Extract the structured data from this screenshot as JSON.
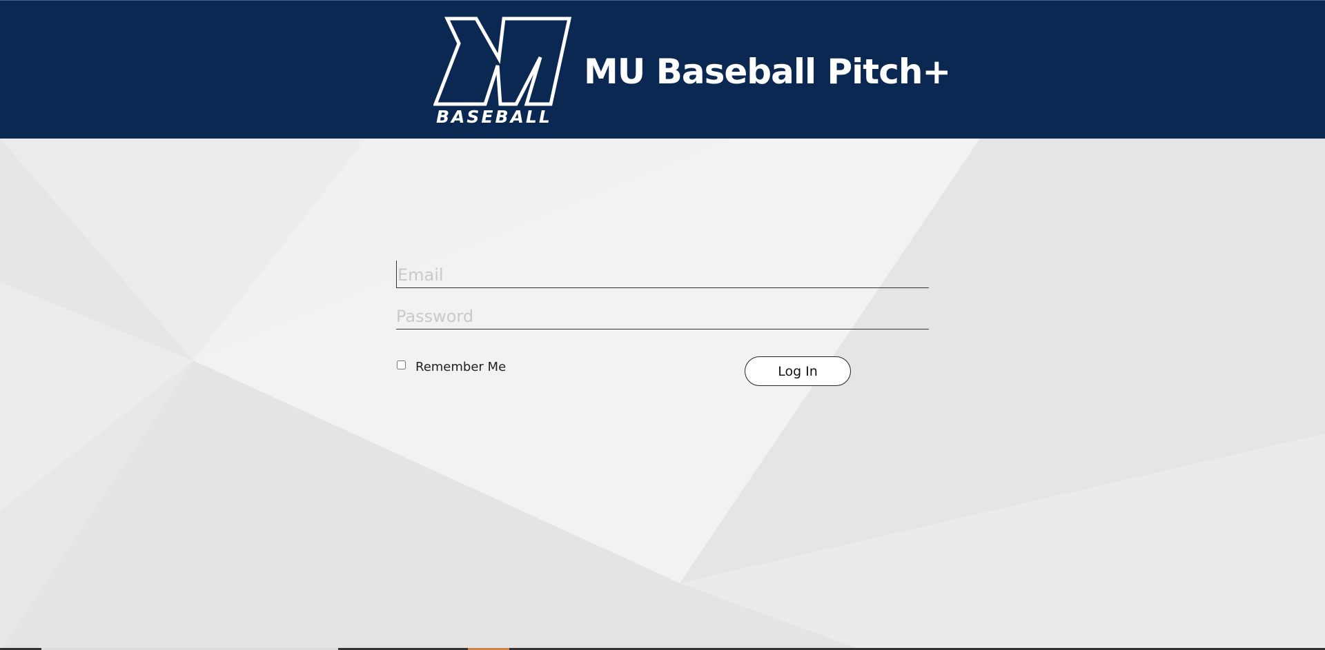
{
  "header": {
    "logo_text": "BASEBALL",
    "logo_letter": "M",
    "title": "MU Baseball Pitch+"
  },
  "login": {
    "email_placeholder": "Email",
    "password_placeholder": "Password",
    "remember_label": "Remember Me",
    "login_button_label": "Log In"
  },
  "colors": {
    "header_bg": "#0b2852",
    "page_bg": "#eeeeee"
  }
}
